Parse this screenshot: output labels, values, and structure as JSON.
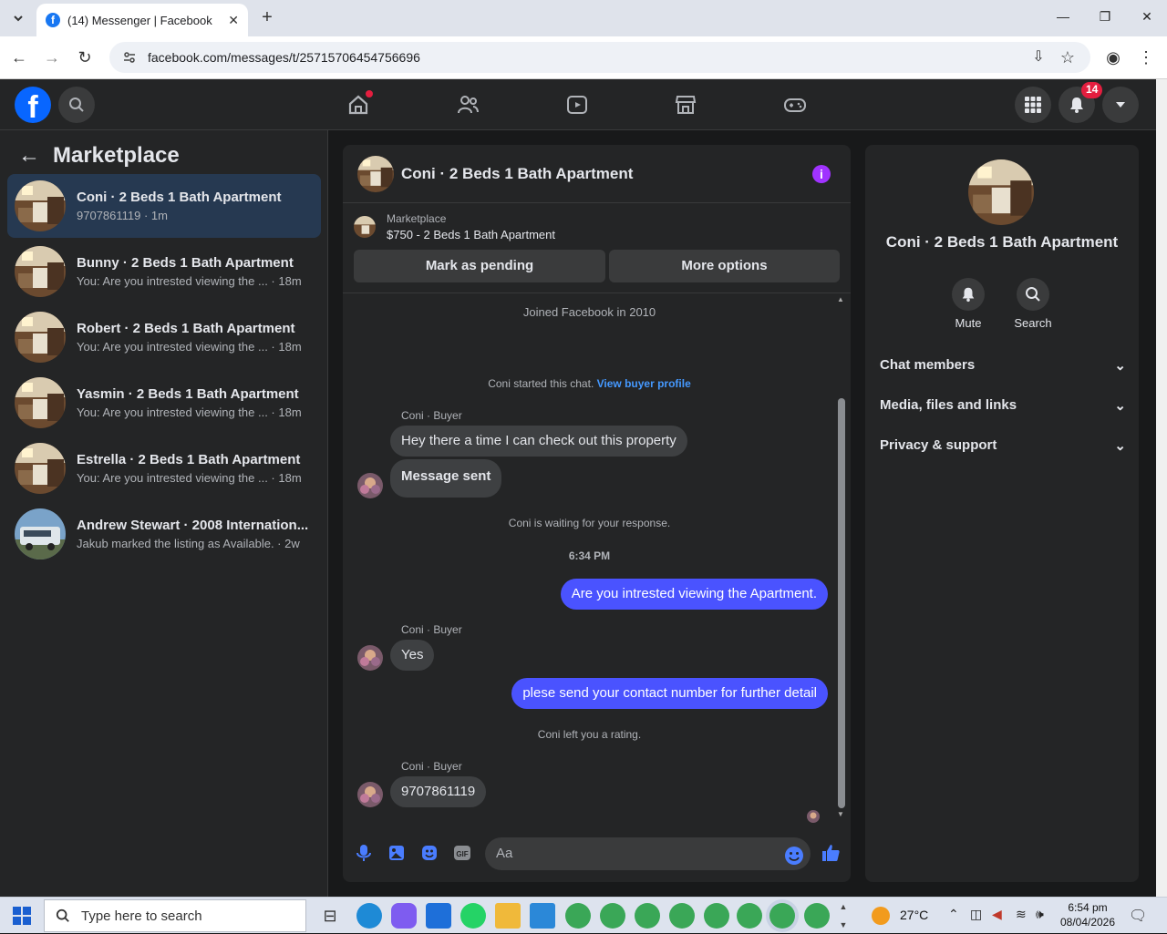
{
  "browser": {
    "tab_title": "(14) Messenger | Facebook",
    "url": "facebook.com/messages/t/25715706454756696"
  },
  "header": {
    "notification_count": "14"
  },
  "left": {
    "title": "Marketplace",
    "conversations": [
      {
        "name": "Coni · 2 Beds 1 Bath Apartment",
        "sub": "9707861119 · 1m",
        "active": true
      },
      {
        "name": "Bunny · 2 Beds 1 Bath Apartment",
        "sub": "You: Are you intrested viewing the ... · 18m"
      },
      {
        "name": "Robert · 2 Beds 1 Bath Apartment",
        "sub": "You: Are you intrested viewing the ... · 18m"
      },
      {
        "name": "Yasmin · 2 Beds 1 Bath Apartment",
        "sub": "You: Are you intrested viewing the ... · 18m"
      },
      {
        "name": "Estrella · 2 Beds 1 Bath Apartment",
        "sub": "You: Are you intrested viewing the ... · 18m"
      },
      {
        "name": "Andrew Stewart · 2008 Internation...",
        "sub": "Jakub marked the listing as Available. · 2w"
      }
    ]
  },
  "chat": {
    "title": "Coni · 2 Beds 1 Bath Apartment",
    "listing_label": "Marketplace",
    "listing_title": "$750 - 2 Beds 1 Bath Apartment",
    "mark_pending": "Mark as pending",
    "more_options": "More options",
    "joined": "Joined Facebook in 2010",
    "started": "Coni started this chat.",
    "view_profile": "View buyer profile",
    "sender": "Coni · Buyer",
    "msg1": "Hey there a time I can check out this property",
    "msg2": "Message sent",
    "waiting": "Coni is waiting for your response.",
    "time": "6:34 PM",
    "me1": "Are you intrested viewing the Apartment.",
    "msg3": "Yes",
    "me2": "plese send your contact number for further detail",
    "rating": "Coni left you a rating.",
    "msg4": "9707861119",
    "input_placeholder": "Aa"
  },
  "right": {
    "name": "Coni · 2 Beds 1 Bath Apartment",
    "mute": "Mute",
    "search": "Search",
    "sections": [
      "Chat members",
      "Media, files and links",
      "Privacy & support"
    ]
  },
  "taskbar": {
    "search_placeholder": "Type here to search",
    "weather": "27°C",
    "time": "6:54 pm",
    "date": "08/04/2026"
  },
  "colors": {
    "accent": "#4a53ff",
    "fb_blue": "#0866ff",
    "badge": "#e41e3f"
  }
}
